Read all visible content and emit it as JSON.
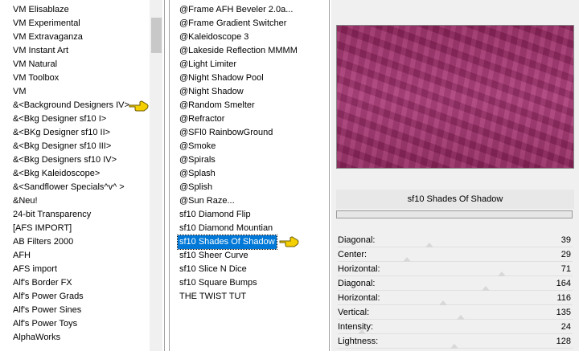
{
  "left_list": {
    "items": [
      "VM Elisablaze",
      "VM Experimental",
      "VM Extravaganza",
      "VM Instant Art",
      "VM Natural",
      "VM Toolbox",
      "VM",
      "&<Background Designers IV>",
      "&<Bkg Designer sf10 I>",
      "&<BKg Designer sf10 II>",
      "&<Bkg Designer sf10 III>",
      "&<Bkg Designers sf10 IV>",
      "&<Bkg Kaleidoscope>",
      "&<Sandflower Specials^v^ >",
      "&Neu!",
      "24-bit Transparency",
      "[AFS IMPORT]",
      "AB Filters 2000",
      "AFH",
      "AFS import",
      "Alf's Border FX",
      "Alf's Power Grads",
      "Alf's Power Sines",
      "Alf's Power Toys",
      "AlphaWorks"
    ]
  },
  "mid_list": {
    "items": [
      "@Frame AFH Beveler 2.0a...",
      "@Frame Gradient Switcher",
      "@Kaleidoscope 3",
      "@Lakeside Reflection MMMM",
      "@Light Limiter",
      "@Night Shadow Pool",
      "@Night Shadow",
      "@Random Smelter",
      "@Refractor",
      "@SFl0 RainbowGround",
      "@Smoke",
      "@Spirals",
      "@Splash",
      "@Splish",
      "@Sun Raze...",
      "sf10 Diamond Flip",
      "sf10 Diamond Mountian",
      "sf10 Shades Of Shadow",
      "sf10 Sheer Curve",
      "sf10 Slice N Dice",
      "sf10 Square Bumps",
      "THE TWIST TUT"
    ],
    "selected_index": 17
  },
  "preview": {
    "colors": {
      "base": "#9a3670",
      "dark": "#7e2356",
      "light": "#b24d86"
    }
  },
  "filter_panel": {
    "title": "sf10 Shades Of Shadow",
    "params": [
      {
        "label": "Diagonal:",
        "value": "39",
        "level": 0.39
      },
      {
        "label": "Center:",
        "value": "29",
        "level": 0.29
      },
      {
        "label": "Horizontal:",
        "value": "71",
        "level": 0.71
      },
      {
        "label": "Diagonal:",
        "value": "164",
        "level": 0.64
      },
      {
        "label": "Horizontal:",
        "value": "116",
        "level": 0.45
      },
      {
        "label": "Vertical:",
        "value": "135",
        "level": 0.53
      },
      {
        "label": "Intensity:",
        "value": "24",
        "level": 0.09
      },
      {
        "label": "Lightness:",
        "value": "128",
        "level": 0.5
      }
    ]
  },
  "icons": {
    "pointer": "hand-pointer-icon"
  },
  "colors": {
    "selection": "#0078d7",
    "pointer": "#f5d000"
  }
}
